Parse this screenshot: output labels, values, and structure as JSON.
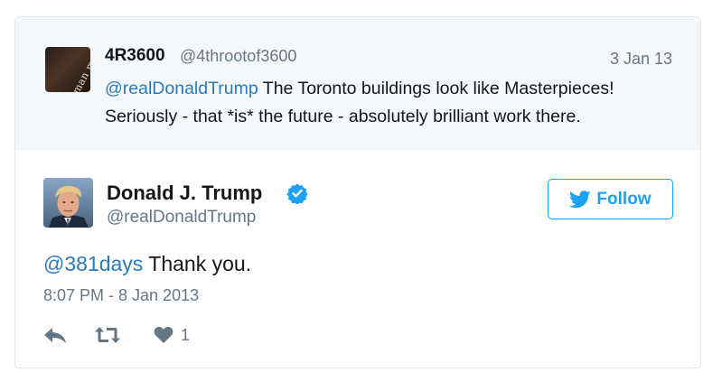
{
  "quoted_tweet": {
    "avatar_text": "herman mutchins",
    "name": "4R3600",
    "handle": "@4throotof3600",
    "date": "3 Jan 13",
    "mention": "@realDonaldTrump",
    "text": " The Toronto buildings look like Masterpieces! Seriously - that *is* the future - absolutely brilliant work there."
  },
  "main_tweet": {
    "name": "Donald J. Trump",
    "handle": "@realDonaldTrump",
    "verified": true,
    "follow_label": "Follow",
    "mention": "@381days",
    "text": " Thank you.",
    "timestamp": "8:07 PM - 8 Jan 2013",
    "actions": {
      "reply_icon": "reply-icon",
      "retweet_icon": "retweet-icon",
      "like_icon": "heart-icon",
      "like_count": "1"
    }
  },
  "colors": {
    "link": "#2b7bb9",
    "accent": "#1da1f2",
    "muted": "#657786",
    "quoted_bg": "#f5f8fa",
    "border": "#e1e8ed"
  }
}
